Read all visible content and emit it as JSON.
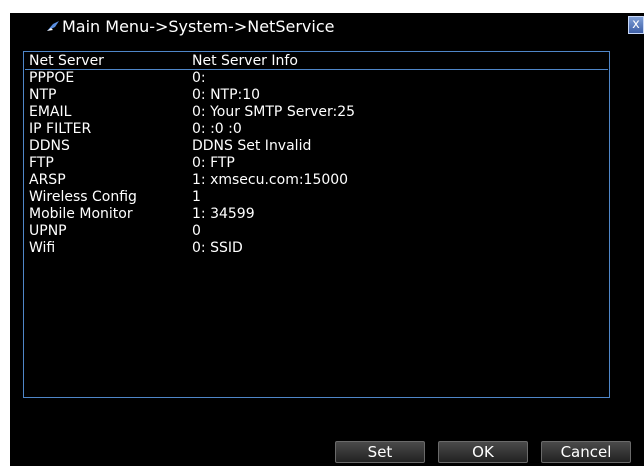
{
  "window": {
    "title": "Main Menu->System->NetService",
    "close_label": "x"
  },
  "table": {
    "headers": [
      "Net Server",
      "Net Server Info"
    ],
    "rows": [
      {
        "server": "PPPOE",
        "info": "0:"
      },
      {
        "server": "NTP",
        "info": "0: NTP:10"
      },
      {
        "server": "EMAIL",
        "info": "0: Your SMTP Server:25"
      },
      {
        "server": "IP FILTER",
        "info": "0: :0 :0"
      },
      {
        "server": "DDNS",
        "info": "DDNS Set Invalid"
      },
      {
        "server": "FTP",
        "info": "0: FTP"
      },
      {
        "server": "ARSP",
        "info": "1: xmsecu.com:15000"
      },
      {
        "server": "Wireless Config",
        "info": "1"
      },
      {
        "server": "Mobile Monitor",
        "info": "1: 34599"
      },
      {
        "server": "UPNP",
        "info": "0"
      },
      {
        "server": "Wifi",
        "info": "0: SSID"
      }
    ]
  },
  "buttons": {
    "set_label": "Set",
    "ok_label": "OK",
    "cancel_label": "Cancel"
  },
  "colors": {
    "background": "#000000",
    "border_blue": "#4f86c8",
    "text": "#ffffff"
  }
}
